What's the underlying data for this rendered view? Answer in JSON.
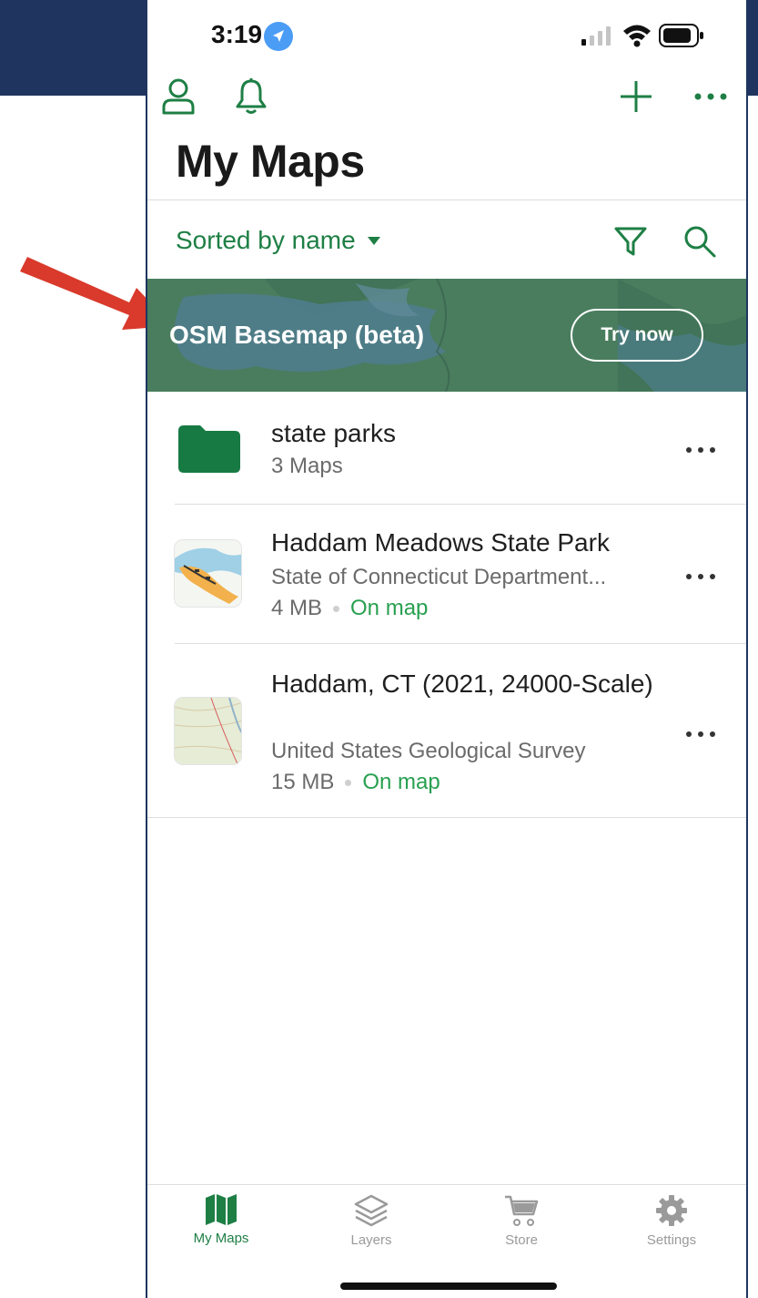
{
  "status_bar": {
    "time": "3:19"
  },
  "header": {
    "title": "My Maps"
  },
  "toolbar": {
    "sort_label": "Sorted by name"
  },
  "promo": {
    "label": "OSM Basemap (beta)",
    "button_label": "Try now"
  },
  "list": {
    "items": [
      {
        "kind": "folder",
        "title": "state parks",
        "subtitle": "3 Maps"
      },
      {
        "kind": "map",
        "title": "Haddam Meadows State Park",
        "subtitle": "State of Connecticut Department...",
        "size": "4 MB",
        "status": "On map"
      },
      {
        "kind": "map",
        "title": "Haddam, CT (2021, 24000-Scale)",
        "subtitle": "United States Geological Survey",
        "size": "15 MB",
        "status": "On map"
      }
    ]
  },
  "tabs": [
    {
      "label": "My Maps",
      "icon": "map-icon",
      "active": true
    },
    {
      "label": "Layers",
      "icon": "layers-icon",
      "active": false
    },
    {
      "label": "Store",
      "icon": "cart-icon",
      "active": false
    },
    {
      "label": "Settings",
      "icon": "gear-icon",
      "active": false
    }
  ],
  "colors": {
    "accent": "#1e7f45",
    "status_green": "#28a050",
    "annotation_red": "#d93a2b",
    "background_band": "#1f3560"
  }
}
